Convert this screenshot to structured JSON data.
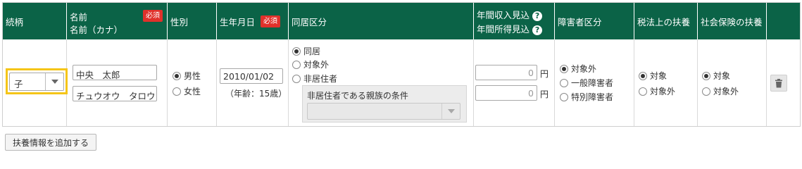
{
  "headers": {
    "relation": "続柄",
    "name": "名前",
    "name_kana": "名前（カナ）",
    "required": "必須",
    "gender": "性別",
    "birthdate": "生年月日",
    "cohabitation": "同居区分",
    "annual_income": "年間収入見込",
    "annual_earnings": "年間所得見込",
    "help": "?",
    "disability": "障害者区分",
    "tax_dependent": "税法上の扶養",
    "social_insurance": "社会保険の扶養"
  },
  "row": {
    "relation_value": "子",
    "name_value": "中央　太郎",
    "kana_value": "チュウオウ　タロウ",
    "gender_options": [
      "男性",
      "女性"
    ],
    "gender_selected": 0,
    "birthdate_value": "2010/01/02",
    "age_text": "（年齢：15歳）",
    "cohabitation_options": [
      "同居",
      "対象外",
      "非居住者"
    ],
    "cohabitation_selected": 0,
    "nonresident_condition_label": "非居住者である親族の条件",
    "income_value": "0",
    "earnings_value": "0",
    "currency_unit": "円",
    "disability_options": [
      "対象外",
      "一般障害者",
      "特別障害者"
    ],
    "disability_selected": 0,
    "tax_options": [
      "対象",
      "対象外"
    ],
    "tax_selected": 0,
    "insurance_options": [
      "対象",
      "対象外"
    ],
    "insurance_selected": 0
  },
  "add_button": "扶養情報を追加する",
  "icons": {
    "delete": "trash-icon",
    "dropdown": "chevron-down-icon",
    "help": "question-circle-icon"
  },
  "colors": {
    "header_bg": "#0b6347",
    "required_badge": "#e0312b",
    "highlight": "#f5c518"
  }
}
